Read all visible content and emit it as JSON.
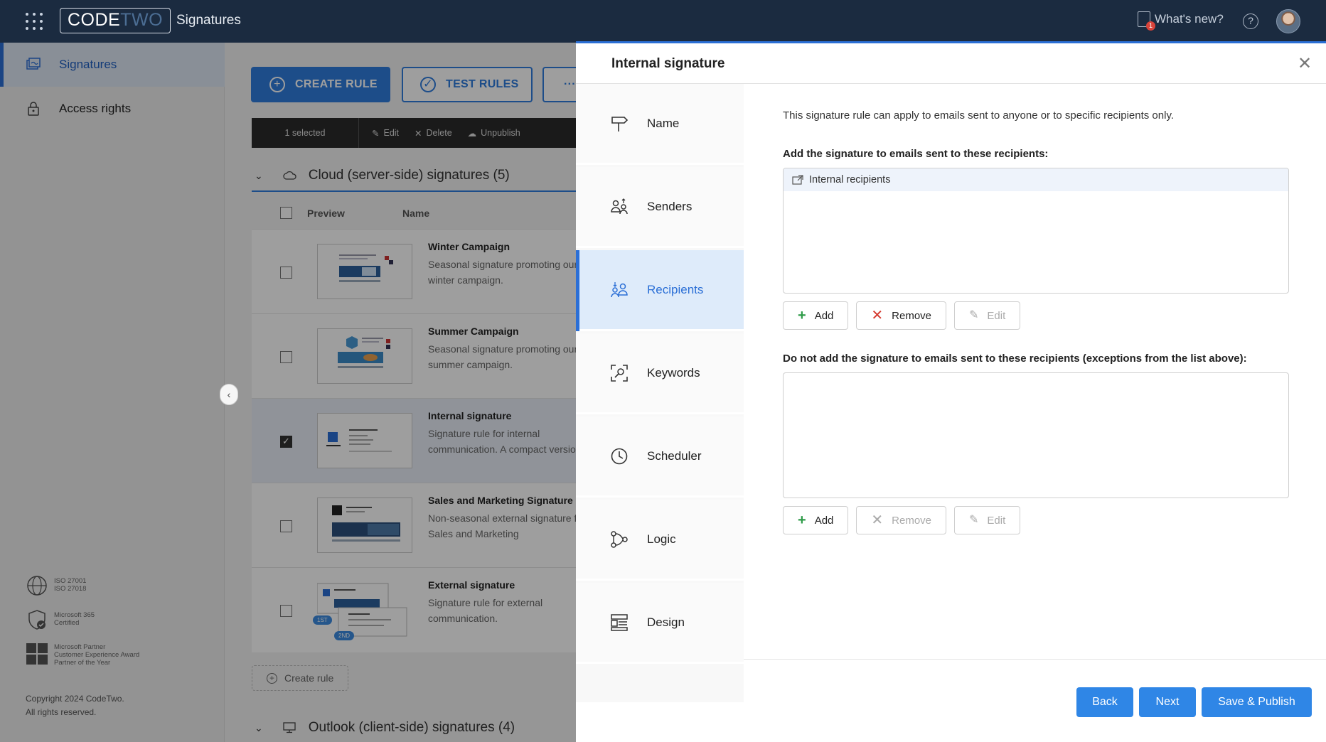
{
  "header": {
    "logo_code": "CODE",
    "logo_two": "TWO",
    "app_title": "Signatures",
    "whats_new": "What's new?",
    "whats_new_badge": "1",
    "help": "?"
  },
  "sidebar": {
    "items": [
      {
        "label": "Signatures",
        "icon": "signatures-icon",
        "active": true
      },
      {
        "label": "Access rights",
        "icon": "lock-icon",
        "active": false
      }
    ],
    "certs": [
      {
        "icon": "globe-icon",
        "lines": [
          "ISO 27001",
          "ISO 27018"
        ]
      },
      {
        "icon": "shield-check-icon",
        "lines": [
          "Microsoft 365",
          "Certified"
        ]
      },
      {
        "icon": "microsoft-logo-icon",
        "lines": [
          "Microsoft Partner",
          "Customer Experience Award",
          "Partner of the Year"
        ]
      }
    ],
    "copyright_1": "Copyright 2024 CodeTwo.",
    "copyright_2": "All rights reserved."
  },
  "main": {
    "create_rule": "CREATE RULE",
    "test_rules": "TEST RULES",
    "more": "···",
    "toolbar": {
      "selected": "1 selected",
      "edit": "Edit",
      "delete": "Delete",
      "unpublish": "Unpublish"
    },
    "group_cloud": "Cloud (server-side) signatures (5)",
    "col_preview": "Preview",
    "col_name": "Name",
    "rows": [
      {
        "name": "Winter Campaign",
        "desc": "Seasonal signature promoting our winter campaign.",
        "checked": false
      },
      {
        "name": "Summer Campaign",
        "desc": "Seasonal signature promoting our summer campaign.",
        "checked": false
      },
      {
        "name": "Internal signature",
        "desc": "Signature rule for internal communication. A compact version",
        "checked": true
      },
      {
        "name": "Sales and Marketing Signature",
        "desc": "Non-seasonal external signature for Sales and Marketing",
        "checked": false
      },
      {
        "name": "External signature",
        "desc": "Signature rule for external communication.",
        "checked": false
      }
    ],
    "thumb_badge_1": "1ST",
    "thumb_badge_2": "2ND",
    "create_rule_link": "Create rule",
    "group_outlook": "Outlook (client-side) signatures (4)"
  },
  "panel": {
    "title": "Internal signature",
    "steps": [
      {
        "label": "Name",
        "icon": "signpost-icon",
        "active": false
      },
      {
        "label": "Senders",
        "icon": "senders-icon",
        "active": false
      },
      {
        "label": "Recipients",
        "icon": "recipients-icon",
        "active": true
      },
      {
        "label": "Keywords",
        "icon": "keywords-icon",
        "active": false
      },
      {
        "label": "Scheduler",
        "icon": "clock-icon",
        "active": false
      },
      {
        "label": "Logic",
        "icon": "logic-icon",
        "active": false
      },
      {
        "label": "Design",
        "icon": "design-icon",
        "active": false
      }
    ],
    "intro": "This signature rule can apply to emails sent to anyone or to specific recipients only.",
    "include_title": "Add the signature to emails sent to these recipients:",
    "include_items": [
      "Internal recipients"
    ],
    "exclude_title": "Do not add the signature to emails sent to these recipients (exceptions from the list above):",
    "buttons": {
      "add": "Add",
      "remove": "Remove",
      "edit": "Edit"
    },
    "footer": {
      "back": "Back",
      "next": "Next",
      "save_publish": "Save & Publish"
    }
  },
  "colors": {
    "topbar": "#1b2b40",
    "accent": "#2b6fd6",
    "primary_button": "#2f86e6"
  }
}
